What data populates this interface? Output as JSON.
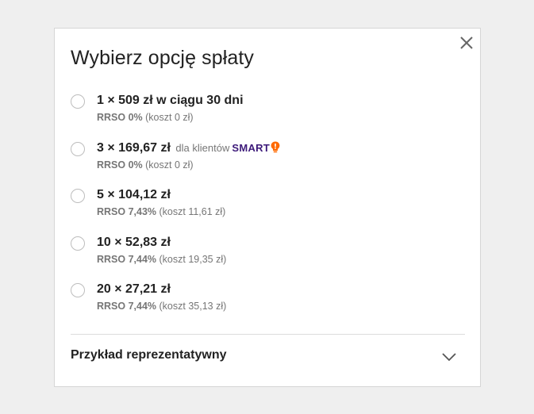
{
  "modal": {
    "title": "Wybierz opcję spłaty",
    "close_icon": "close-icon"
  },
  "options": [
    {
      "main": "1 × 509 zł w ciągu 30 dni",
      "rrso": "RRSO 0%",
      "cost": "(koszt 0 zł)",
      "selected": false
    },
    {
      "main": "3 × 169,67 zł",
      "extra": "dla klientów",
      "badge": "SMART",
      "badge_icon": "smart-bulb-icon",
      "rrso": "RRSO 0%",
      "cost": "(koszt 0 zł)",
      "selected": false
    },
    {
      "main": "5 × 104,12 zł",
      "rrso": "RRSO 7,43%",
      "cost": "(koszt 11,61 zł)",
      "selected": false
    },
    {
      "main": "10 × 52,83 zł",
      "rrso": "RRSO 7,44%",
      "cost": "(koszt 19,35 zł)",
      "selected": false
    },
    {
      "main": "20 × 27,21 zł",
      "rrso": "RRSO 7,44%",
      "cost": "(koszt 35,13 zł)",
      "selected": false
    }
  ],
  "example": {
    "label": "Przykład reprezentatywny",
    "icon": "chevron-down-icon"
  },
  "colors": {
    "smart_text": "#3d1a7a",
    "smart_icon": "#ff6a00",
    "text_primary": "#222222",
    "text_secondary": "#767676",
    "background": "#efefef"
  }
}
